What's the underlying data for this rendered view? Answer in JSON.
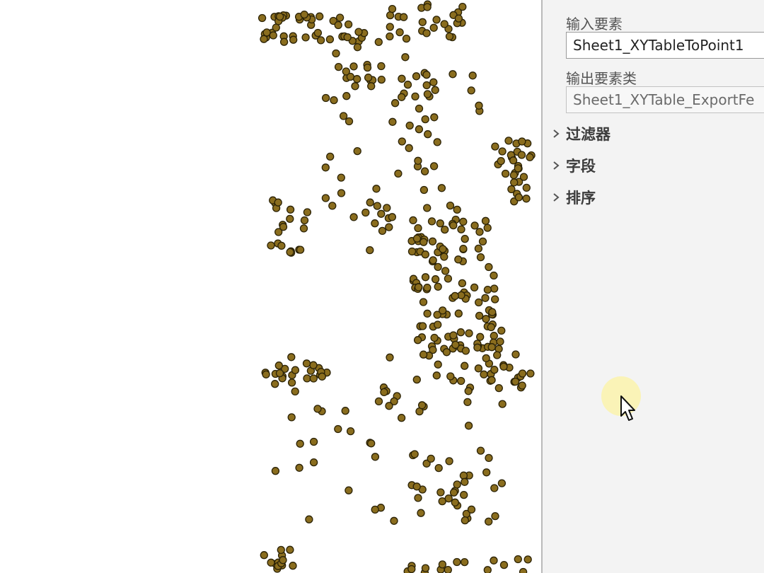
{
  "panel": {
    "input_features": {
      "label": "输入要素",
      "value": "Sheet1_XYTableToPoint1"
    },
    "output_feature_class": {
      "label": "输出要素类",
      "value": "Sheet1_XYTable_ExportFe"
    },
    "sections": [
      {
        "label": "过滤器",
        "icon": "chevron-right-icon"
      },
      {
        "label": "字段",
        "icon": "chevron-right-icon"
      },
      {
        "label": "排序",
        "icon": "chevron-right-icon"
      }
    ]
  },
  "map": {
    "point_fill": "#8a6d1e",
    "point_stroke": "#2b2206"
  },
  "colors": {
    "panel_background": "#f3f3f3",
    "cursor_highlight": "#fbf3b0"
  }
}
